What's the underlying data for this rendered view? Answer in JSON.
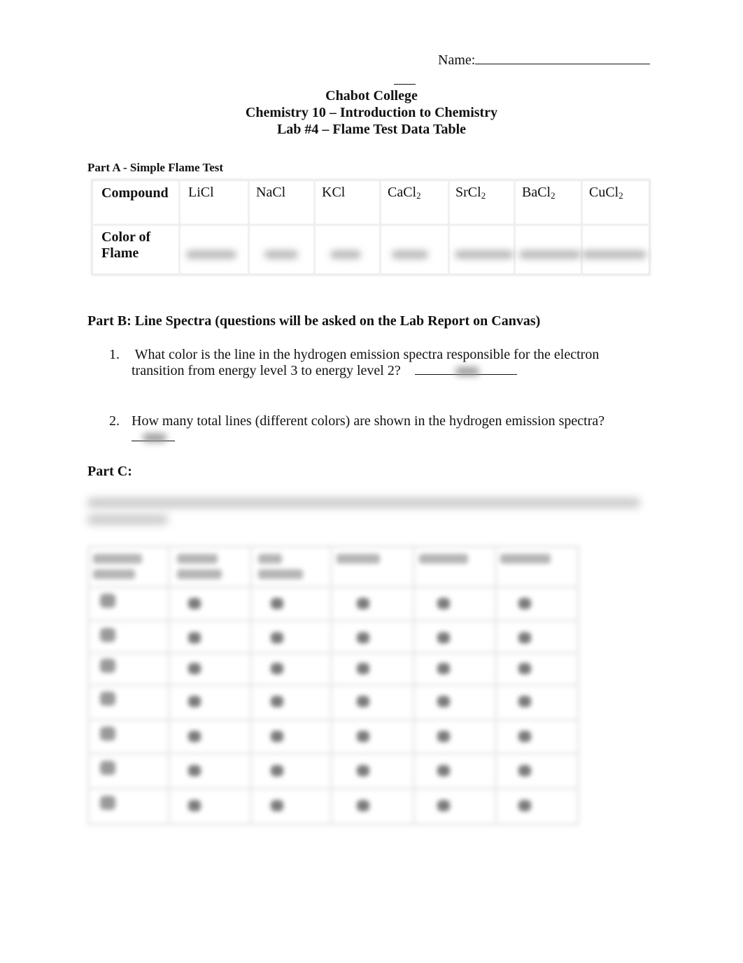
{
  "header": {
    "name_label": "Name:",
    "title_lines": [
      "Chabot College",
      "Chemistry 10 – Introduction to Chemistry",
      "Lab #4 – Flame Test Data Table"
    ]
  },
  "partA": {
    "label": "Part A - Simple Flame Test",
    "row_labels": {
      "compound": "Compound",
      "color_line1": "Color of",
      "color_line2": "Flame"
    },
    "compounds": [
      {
        "base": "LiCl",
        "sub": ""
      },
      {
        "base": "NaCl",
        "sub": ""
      },
      {
        "base": "KCl",
        "sub": ""
      },
      {
        "base": "CaCl",
        "sub": "2"
      },
      {
        "base": "SrCl",
        "sub": "2"
      },
      {
        "base": "BaCl",
        "sub": "2"
      },
      {
        "base": "CuCl",
        "sub": "2"
      }
    ],
    "flame_colors_obscured": true
  },
  "partB": {
    "label": "Part B:  Line Spectra (questions will be asked on the Lab Report on Canvas)",
    "questions": [
      {
        "number": "1.",
        "line1": " What color is the line in the hydrogen emission spectra responsible for the electron",
        "line2": "transition from energy level 3 to energy level 2?",
        "answer_obscured": true
      },
      {
        "number": "2.",
        "line1": "How many total lines (different colors) are shown in the hydrogen emission spectra?",
        "answer_obscured": true
      }
    ]
  },
  "partC": {
    "label": "Part C:",
    "instructions_obscured": true,
    "table_obscured": true,
    "table_columns": 6,
    "table_rows": 7
  }
}
